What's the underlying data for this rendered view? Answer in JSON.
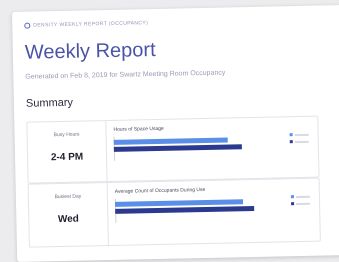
{
  "header": {
    "brand_line": "DENSITY WEEKLY REPORT (OCCUPANCY)"
  },
  "report": {
    "title": "Weekly Report",
    "subtitle": "Generated on Feb 8, 2019 for Swartz Meeting Room Occupancy",
    "section": "Summary"
  },
  "colors": {
    "accent": "#4a53a6",
    "bar_light": "#5b8ee6",
    "bar_dark": "#2b3a8f"
  },
  "panels": [
    {
      "stat_label": "Busy Hours",
      "stat_value": "2-4 PM",
      "chart_title": "Hours of Space Usage"
    },
    {
      "stat_label": "Busiest Day",
      "stat_value": "Wed",
      "chart_title": "Average Count of Occupants During Use"
    }
  ],
  "chart_data": [
    {
      "type": "bar",
      "title": "Hours of Space Usage",
      "series": [
        {
          "values": [
            0.82
          ]
        },
        {
          "values": [
            0.92
          ]
        }
      ]
    },
    {
      "type": "bar",
      "title": "Average Count of Occupants During Use",
      "series": [
        {
          "values": [
            0.92
          ]
        },
        {
          "values": [
            1.0
          ]
        }
      ]
    }
  ]
}
